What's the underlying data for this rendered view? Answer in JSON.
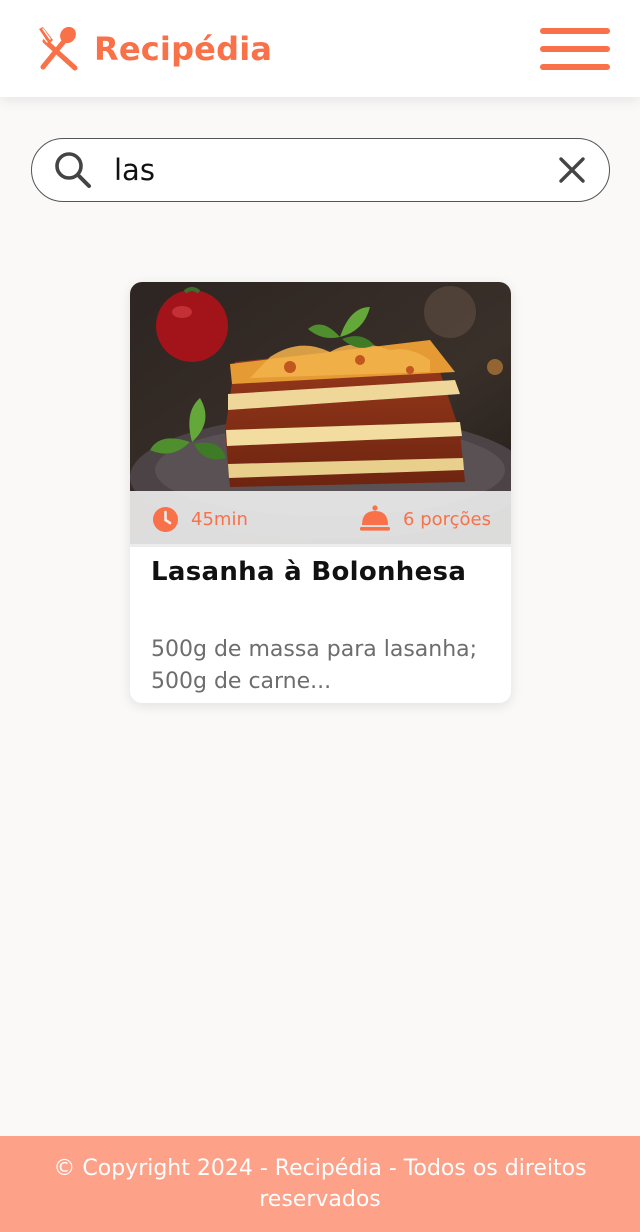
{
  "header": {
    "brand_name": "Recipédia",
    "brand_icon": "fork-spoon-icon",
    "menu_icon": "hamburger-menu-icon"
  },
  "search": {
    "value": "las",
    "placeholder": "",
    "search_icon": "search-icon",
    "clear_icon": "close-icon"
  },
  "results": [
    {
      "image": "lasagna-photo",
      "time": "45min",
      "servings": "6 porções",
      "title": "Lasanha à Bolonhesa",
      "description": "500g de massa para lasanha; 500g de carne..."
    }
  ],
  "footer": {
    "text": "© Copyright 2024 - Recipédia - Todos os direitos reservados"
  },
  "colors": {
    "accent": "#f87148",
    "footer_bg": "#fda189",
    "page_bg": "#faf9f8"
  }
}
